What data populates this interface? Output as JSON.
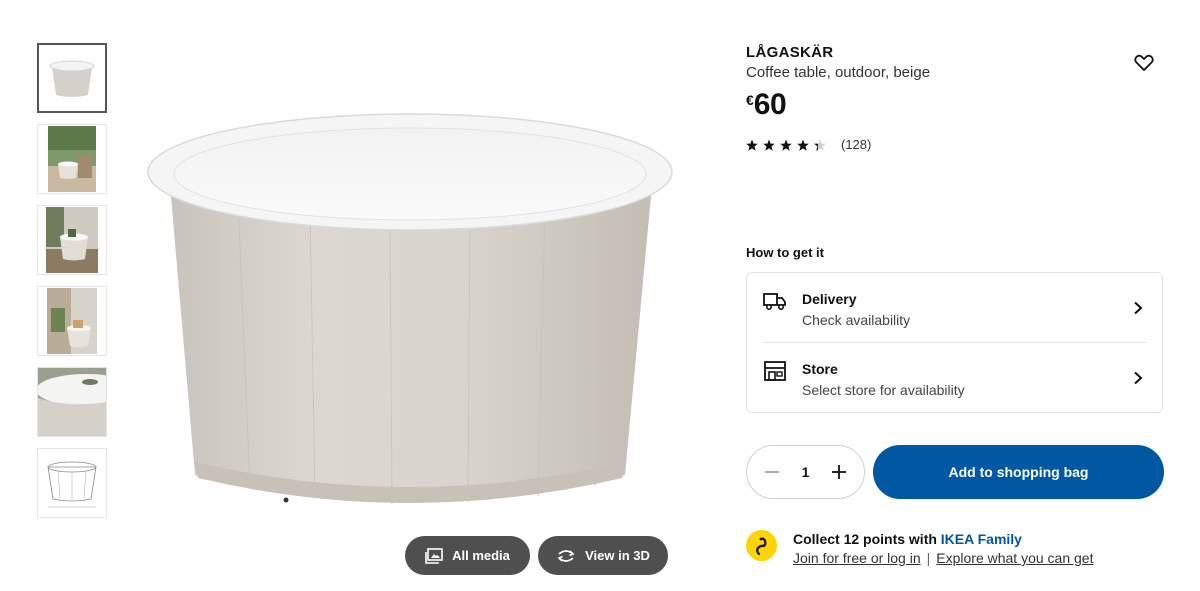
{
  "gallery": {
    "thumbnails": [
      "table-front",
      "patio-scene",
      "room-scene",
      "balcony-scene",
      "top-closeup",
      "dimension-drawing"
    ],
    "selected_index": 0,
    "all_media_label": "All media",
    "view_3d_label": "View in 3D"
  },
  "product": {
    "name": "LÅGASKÄR",
    "description": "Coffee table, outdoor, beige",
    "currency": "€",
    "price": "60",
    "rating_stars": 4.5,
    "rating_count": "(128)"
  },
  "how_to_get": {
    "title": "How to get it",
    "options": [
      {
        "icon": "truck-icon",
        "title": "Delivery",
        "subtitle": "Check availability"
      },
      {
        "icon": "store-icon",
        "title": "Store",
        "subtitle": "Select store for availability"
      }
    ]
  },
  "cart": {
    "quantity": "1",
    "add_label": "Add to shopping bag"
  },
  "family": {
    "title_prefix": "Collect 12 points with ",
    "brand": "IKEA Family",
    "link_join": "Join for free or log in",
    "separator": "|",
    "link_explore": "Explore what you can get"
  },
  "colors": {
    "primary_blue": "#0058a3",
    "family_yellow": "#ffd400",
    "dark_button": "#4f4f4f",
    "product_beige": "#d8d4cd"
  }
}
